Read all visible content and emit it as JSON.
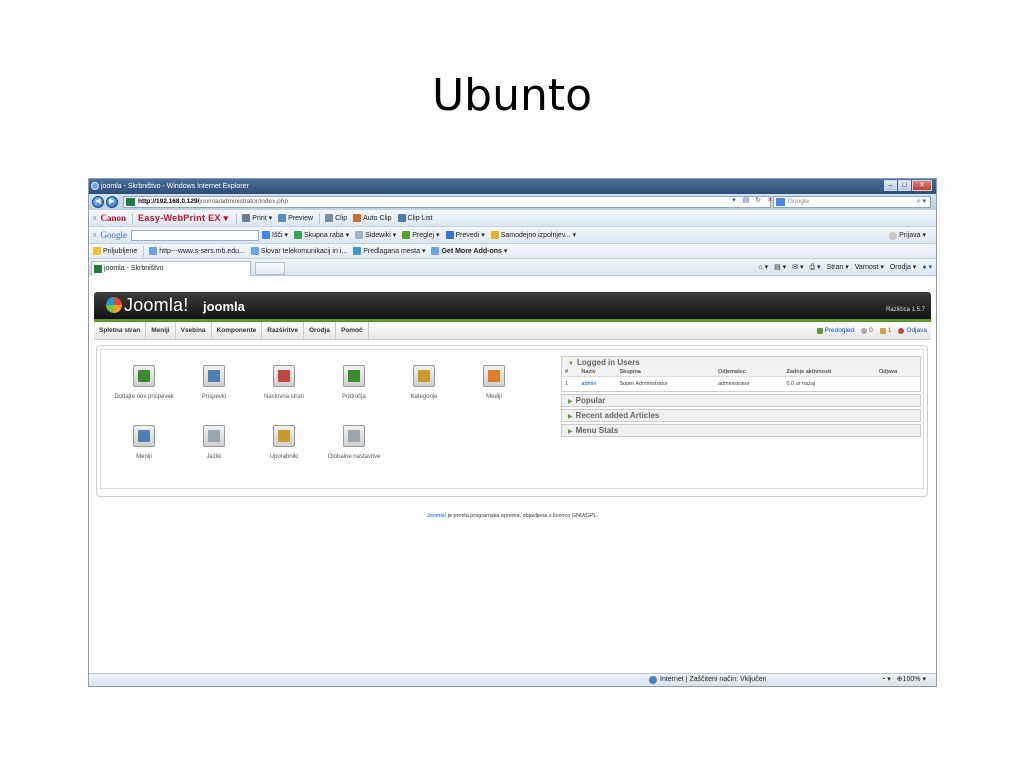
{
  "slide": {
    "title": "Ubunto"
  },
  "window": {
    "title": "joomla - Skrbništvo - Windows Internet Explorer",
    "url_host": "http://192.168.0.129/",
    "url_path": "joomla/administrator/index.php",
    "search_placeholder": "Google"
  },
  "canon_toolbar": {
    "brand": "Canon",
    "product": "Easy-WebPrint EX ▾",
    "items": [
      "Print ▾",
      "Preview",
      "Clip",
      "Auto Clip",
      "Clip List"
    ]
  },
  "google_toolbar": {
    "brand": "Google",
    "items": [
      "Išči ▾",
      "Skupna raba ▾",
      "Sidewiki ▾",
      "Preglej ▾",
      "Prevedi ▾",
      "Samodejno izpolnjev... ▾"
    ],
    "signin": "Prijava ▾"
  },
  "favorites_bar": {
    "label": "Priljubljene",
    "items": [
      "http---www.s-sers.mb.edu...",
      "Slovar telekomunikacij in i...",
      "Predlagana mesta ▾",
      "Get More Add-ons ▾"
    ]
  },
  "tabs": {
    "active": "joomla - Skrbništvo"
  },
  "command_bar": {
    "items": [
      "Stran ▾",
      "Varnost ▾",
      "Orodja ▾"
    ]
  },
  "joomla": {
    "brand": "Joomla!",
    "site": "joomla",
    "version": "Različica 1.5.7",
    "menu": [
      "Spletna stran",
      "Meniji",
      "Vsebina",
      "Komponente",
      "Razširitve",
      "Orodja",
      "Pomoč"
    ],
    "status": {
      "preview": "Predogled",
      "messages": "0",
      "users_online": "1",
      "logout": "Odjava"
    },
    "cpanel_icons": [
      {
        "label": "Dodajte nov prispevek",
        "icon": "add-article-icon"
      },
      {
        "label": "Prispevki",
        "icon": "article-manager-icon"
      },
      {
        "label": "Naslovna stran",
        "icon": "frontpage-icon"
      },
      {
        "label": "Področja",
        "icon": "section-icon"
      },
      {
        "label": "Kategorije",
        "icon": "category-icon"
      },
      {
        "label": "Mediji",
        "icon": "media-icon"
      },
      {
        "label": "Meniji",
        "icon": "menu-icon"
      },
      {
        "label": "Jeziki",
        "icon": "language-icon"
      },
      {
        "label": "Uporabniki",
        "icon": "users-icon"
      },
      {
        "label": "Globalne nastavitve",
        "icon": "global-config-icon"
      }
    ],
    "logged_in": {
      "title": "Logged in Users",
      "columns": [
        "#",
        "Naziv",
        "Skupina",
        "Odjemalec",
        "Zadnje aktivnosti",
        "Odjava"
      ],
      "rows": [
        [
          "1",
          "admin",
          "Super Administrator",
          "administrator",
          "0.0 ur nazaj",
          ""
        ]
      ]
    },
    "modules": [
      "Popular",
      "Recent added Articles",
      "Menu Stats"
    ],
    "footer_link": "Joomla!",
    "footer_text": " je prosta programska oprema, objavljena z licenco GNU/GPL."
  },
  "statusbar": {
    "zone": "Internet | Zaščiteni način: Vključen",
    "zoom": "100%"
  }
}
